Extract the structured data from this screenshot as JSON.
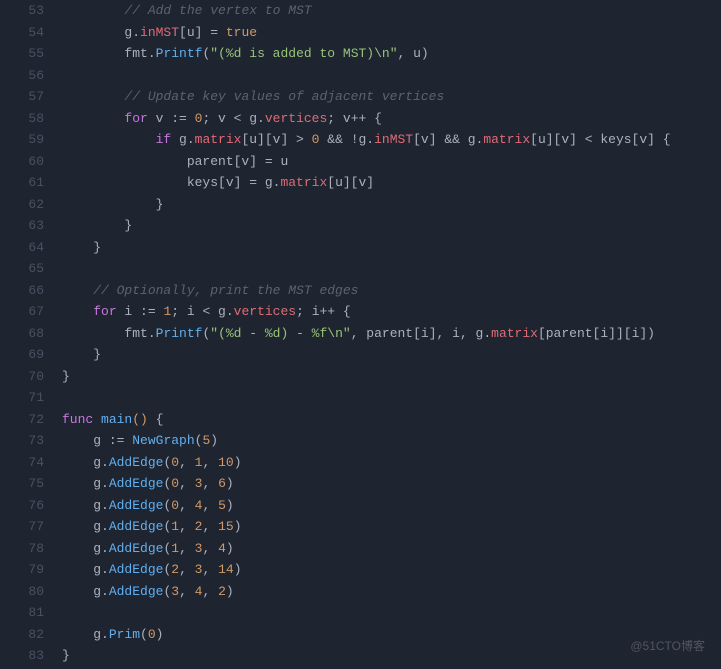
{
  "watermark": "@51CTO博客",
  "lines": [
    {
      "num": "53",
      "indent": "        ",
      "tokens": [
        {
          "t": "comment",
          "v": "// Add the vertex to MST"
        }
      ]
    },
    {
      "num": "54",
      "indent": "        ",
      "tokens": [
        {
          "t": "plain",
          "v": "g."
        },
        {
          "t": "ident",
          "v": "inMST"
        },
        {
          "t": "plain",
          "v": "[u] = "
        },
        {
          "t": "boolean",
          "v": "true"
        }
      ]
    },
    {
      "num": "55",
      "indent": "        ",
      "tokens": [
        {
          "t": "plain",
          "v": "fmt."
        },
        {
          "t": "func",
          "v": "Printf"
        },
        {
          "t": "plain",
          "v": "("
        },
        {
          "t": "string",
          "v": "\"(%d is added to MST)\\n\""
        },
        {
          "t": "plain",
          "v": ", u)"
        }
      ]
    },
    {
      "num": "56",
      "indent": "",
      "tokens": []
    },
    {
      "num": "57",
      "indent": "        ",
      "tokens": [
        {
          "t": "comment",
          "v": "// Update key values of adjacent vertices"
        }
      ]
    },
    {
      "num": "58",
      "indent": "        ",
      "tokens": [
        {
          "t": "keyword",
          "v": "for"
        },
        {
          "t": "plain",
          "v": " v := "
        },
        {
          "t": "number",
          "v": "0"
        },
        {
          "t": "plain",
          "v": "; v < g."
        },
        {
          "t": "ident",
          "v": "vertices"
        },
        {
          "t": "plain",
          "v": "; v++ {"
        }
      ]
    },
    {
      "num": "59",
      "indent": "            ",
      "tokens": [
        {
          "t": "keyword",
          "v": "if"
        },
        {
          "t": "plain",
          "v": " g."
        },
        {
          "t": "ident",
          "v": "matrix"
        },
        {
          "t": "plain",
          "v": "[u][v] > "
        },
        {
          "t": "number",
          "v": "0"
        },
        {
          "t": "plain",
          "v": " && !g."
        },
        {
          "t": "ident",
          "v": "inMST"
        },
        {
          "t": "plain",
          "v": "[v] && g."
        },
        {
          "t": "ident",
          "v": "matrix"
        },
        {
          "t": "plain",
          "v": "[u][v] < keys[v] {"
        }
      ]
    },
    {
      "num": "60",
      "indent": "                ",
      "tokens": [
        {
          "t": "plain",
          "v": "parent[v] = u"
        }
      ]
    },
    {
      "num": "61",
      "indent": "                ",
      "tokens": [
        {
          "t": "plain",
          "v": "keys[v] = g."
        },
        {
          "t": "ident",
          "v": "matrix"
        },
        {
          "t": "plain",
          "v": "[u][v]"
        }
      ]
    },
    {
      "num": "62",
      "indent": "            ",
      "tokens": [
        {
          "t": "plain",
          "v": "}"
        }
      ]
    },
    {
      "num": "63",
      "indent": "        ",
      "tokens": [
        {
          "t": "plain",
          "v": "}"
        }
      ]
    },
    {
      "num": "64",
      "indent": "    ",
      "tokens": [
        {
          "t": "plain",
          "v": "}"
        }
      ]
    },
    {
      "num": "65",
      "indent": "",
      "tokens": []
    },
    {
      "num": "66",
      "indent": "    ",
      "tokens": [
        {
          "t": "comment",
          "v": "// Optionally, print the MST edges"
        }
      ]
    },
    {
      "num": "67",
      "indent": "    ",
      "tokens": [
        {
          "t": "keyword",
          "v": "for"
        },
        {
          "t": "plain",
          "v": " i := "
        },
        {
          "t": "number",
          "v": "1"
        },
        {
          "t": "plain",
          "v": "; i < g."
        },
        {
          "t": "ident",
          "v": "vertices"
        },
        {
          "t": "plain",
          "v": "; i++ {"
        }
      ]
    },
    {
      "num": "68",
      "indent": "        ",
      "tokens": [
        {
          "t": "plain",
          "v": "fmt."
        },
        {
          "t": "func",
          "v": "Printf"
        },
        {
          "t": "plain",
          "v": "("
        },
        {
          "t": "string",
          "v": "\"(%d - %d) - %f\\n\""
        },
        {
          "t": "plain",
          "v": ", parent[i], i, g."
        },
        {
          "t": "ident",
          "v": "matrix"
        },
        {
          "t": "plain",
          "v": "[parent[i]][i])"
        }
      ]
    },
    {
      "num": "69",
      "indent": "    ",
      "tokens": [
        {
          "t": "plain",
          "v": "}"
        }
      ]
    },
    {
      "num": "70",
      "indent": "",
      "tokens": [
        {
          "t": "plain",
          "v": "}"
        }
      ]
    },
    {
      "num": "71",
      "indent": "",
      "tokens": []
    },
    {
      "num": "72",
      "indent": "",
      "tokens": [
        {
          "t": "keyword",
          "v": "func"
        },
        {
          "t": "plain",
          "v": " "
        },
        {
          "t": "func",
          "v": "main"
        },
        {
          "t": "paren",
          "v": "()"
        },
        {
          "t": "plain",
          "v": " {"
        }
      ]
    },
    {
      "num": "73",
      "indent": "    ",
      "tokens": [
        {
          "t": "plain",
          "v": "g := "
        },
        {
          "t": "func",
          "v": "NewGraph"
        },
        {
          "t": "plain",
          "v": "("
        },
        {
          "t": "number",
          "v": "5"
        },
        {
          "t": "plain",
          "v": ")"
        }
      ]
    },
    {
      "num": "74",
      "indent": "    ",
      "tokens": [
        {
          "t": "plain",
          "v": "g."
        },
        {
          "t": "func",
          "v": "AddEdge"
        },
        {
          "t": "plain",
          "v": "("
        },
        {
          "t": "number",
          "v": "0"
        },
        {
          "t": "plain",
          "v": ", "
        },
        {
          "t": "number",
          "v": "1"
        },
        {
          "t": "plain",
          "v": ", "
        },
        {
          "t": "number",
          "v": "10"
        },
        {
          "t": "plain",
          "v": ")"
        }
      ]
    },
    {
      "num": "75",
      "indent": "    ",
      "tokens": [
        {
          "t": "plain",
          "v": "g."
        },
        {
          "t": "func",
          "v": "AddEdge"
        },
        {
          "t": "plain",
          "v": "("
        },
        {
          "t": "number",
          "v": "0"
        },
        {
          "t": "plain",
          "v": ", "
        },
        {
          "t": "number",
          "v": "3"
        },
        {
          "t": "plain",
          "v": ", "
        },
        {
          "t": "number",
          "v": "6"
        },
        {
          "t": "plain",
          "v": ")"
        }
      ]
    },
    {
      "num": "76",
      "indent": "    ",
      "tokens": [
        {
          "t": "plain",
          "v": "g."
        },
        {
          "t": "func",
          "v": "AddEdge"
        },
        {
          "t": "plain",
          "v": "("
        },
        {
          "t": "number",
          "v": "0"
        },
        {
          "t": "plain",
          "v": ", "
        },
        {
          "t": "number",
          "v": "4"
        },
        {
          "t": "plain",
          "v": ", "
        },
        {
          "t": "number",
          "v": "5"
        },
        {
          "t": "plain",
          "v": ")"
        }
      ]
    },
    {
      "num": "77",
      "indent": "    ",
      "tokens": [
        {
          "t": "plain",
          "v": "g."
        },
        {
          "t": "func",
          "v": "AddEdge"
        },
        {
          "t": "plain",
          "v": "("
        },
        {
          "t": "number",
          "v": "1"
        },
        {
          "t": "plain",
          "v": ", "
        },
        {
          "t": "number",
          "v": "2"
        },
        {
          "t": "plain",
          "v": ", "
        },
        {
          "t": "number",
          "v": "15"
        },
        {
          "t": "plain",
          "v": ")"
        }
      ]
    },
    {
      "num": "78",
      "indent": "    ",
      "tokens": [
        {
          "t": "plain",
          "v": "g."
        },
        {
          "t": "func",
          "v": "AddEdge"
        },
        {
          "t": "plain",
          "v": "("
        },
        {
          "t": "number",
          "v": "1"
        },
        {
          "t": "plain",
          "v": ", "
        },
        {
          "t": "number",
          "v": "3"
        },
        {
          "t": "plain",
          "v": ", "
        },
        {
          "t": "number",
          "v": "4"
        },
        {
          "t": "plain",
          "v": ")"
        }
      ]
    },
    {
      "num": "79",
      "indent": "    ",
      "tokens": [
        {
          "t": "plain",
          "v": "g."
        },
        {
          "t": "func",
          "v": "AddEdge"
        },
        {
          "t": "plain",
          "v": "("
        },
        {
          "t": "number",
          "v": "2"
        },
        {
          "t": "plain",
          "v": ", "
        },
        {
          "t": "number",
          "v": "3"
        },
        {
          "t": "plain",
          "v": ", "
        },
        {
          "t": "number",
          "v": "14"
        },
        {
          "t": "plain",
          "v": ")"
        }
      ]
    },
    {
      "num": "80",
      "indent": "    ",
      "tokens": [
        {
          "t": "plain",
          "v": "g."
        },
        {
          "t": "func",
          "v": "AddEdge"
        },
        {
          "t": "plain",
          "v": "("
        },
        {
          "t": "number",
          "v": "3"
        },
        {
          "t": "plain",
          "v": ", "
        },
        {
          "t": "number",
          "v": "4"
        },
        {
          "t": "plain",
          "v": ", "
        },
        {
          "t": "number",
          "v": "2"
        },
        {
          "t": "plain",
          "v": ")"
        }
      ]
    },
    {
      "num": "81",
      "indent": "",
      "tokens": []
    },
    {
      "num": "82",
      "indent": "    ",
      "tokens": [
        {
          "t": "plain",
          "v": "g."
        },
        {
          "t": "func",
          "v": "Prim"
        },
        {
          "t": "plain",
          "v": "("
        },
        {
          "t": "number",
          "v": "0"
        },
        {
          "t": "plain",
          "v": ")"
        }
      ]
    },
    {
      "num": "83",
      "indent": "",
      "tokens": [
        {
          "t": "plain",
          "v": "}"
        }
      ]
    }
  ]
}
